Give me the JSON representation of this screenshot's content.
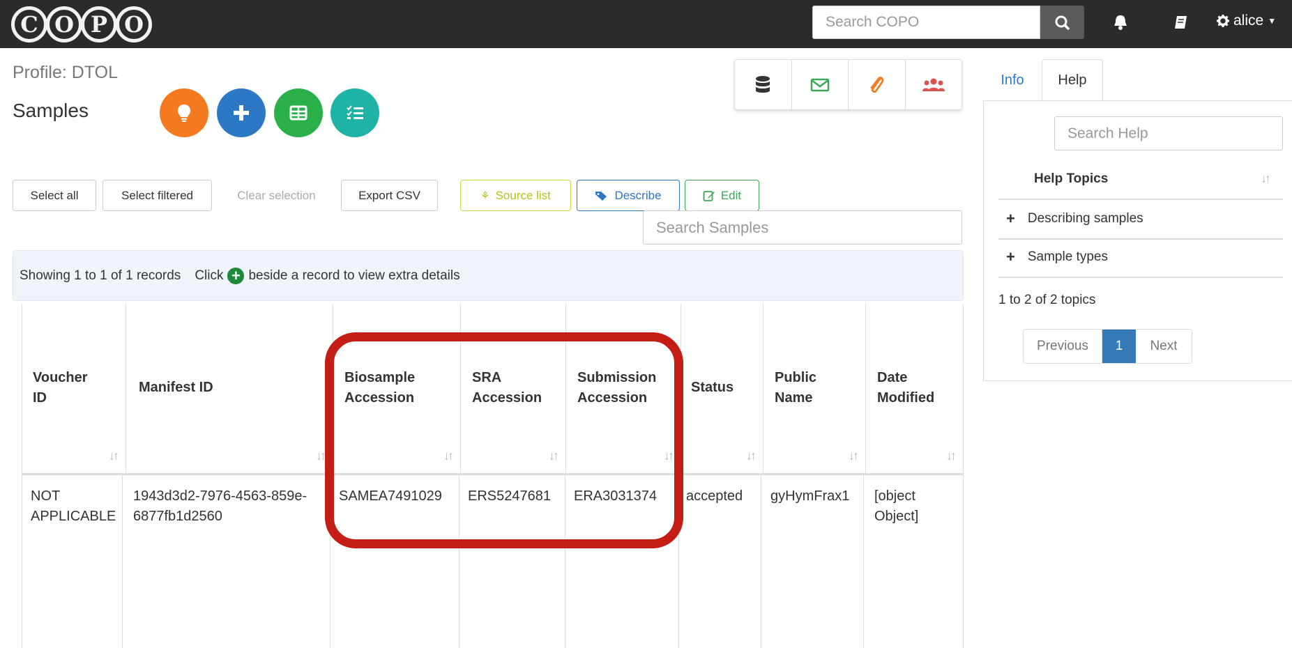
{
  "nav": {
    "logo_letters": [
      "C",
      "O",
      "P",
      "O"
    ],
    "search_placeholder": "Search COPO",
    "user": "alice"
  },
  "header": {
    "profile": "Profile: DTOL",
    "title": "Samples"
  },
  "action_circles": [
    {
      "icon": "lightbulb-icon",
      "color": "#f47a20"
    },
    {
      "icon": "plus-icon",
      "color": "#2d78c5"
    },
    {
      "icon": "table-icon",
      "color": "#29b048"
    },
    {
      "icon": "checklist-icon",
      "color": "#1fb3a6"
    }
  ],
  "icon_group_colors": {
    "database": "#333333",
    "envelope": "#3aa856",
    "paperclip": "#f47a20",
    "users": "#d9534f"
  },
  "toolbar": {
    "select_all": "Select all",
    "select_filtered": "Select filtered",
    "clear_selection": "Clear selection",
    "export_csv": "Export CSV",
    "source_list": "Source list",
    "describe": "Describe",
    "edit": "Edit"
  },
  "search_samples_placeholder": "Search Samples",
  "info_bar": {
    "showing": "Showing 1 to 1 of 1 records",
    "click": "Click",
    "beside": "beside a record to view extra details"
  },
  "table": {
    "headers": {
      "voucher": [
        "Voucher",
        "ID"
      ],
      "manifest": [
        "Manifest ID"
      ],
      "biosample": [
        "Biosample",
        "Accession"
      ],
      "sra": [
        "SRA",
        "Accession"
      ],
      "submission": [
        "Submission",
        "Accession"
      ],
      "status": [
        "Status"
      ],
      "public": [
        "Public",
        "Name"
      ],
      "date": [
        "Date",
        "Modified"
      ]
    },
    "row": {
      "voucher": [
        "NOT",
        "APPLICABLE"
      ],
      "manifest": [
        "1943d3d2-7976-4563-859e-",
        "6877fb1d2560"
      ],
      "biosample": "SAMEA7491029",
      "sra": "ERS5247681",
      "submission": "ERA3031374",
      "status": "accepted",
      "public": "gyHymFrax1",
      "date": [
        "[object",
        "Object]"
      ]
    }
  },
  "side": {
    "tab_info": "Info",
    "tab_help": "Help",
    "search_help_placeholder": "Search Help",
    "help_topics": "Help Topics",
    "topics": [
      "Describing samples",
      "Sample types"
    ],
    "topic_count": "1 to 2 of 2 topics",
    "prev": "Previous",
    "page": "1",
    "next": "Next"
  }
}
